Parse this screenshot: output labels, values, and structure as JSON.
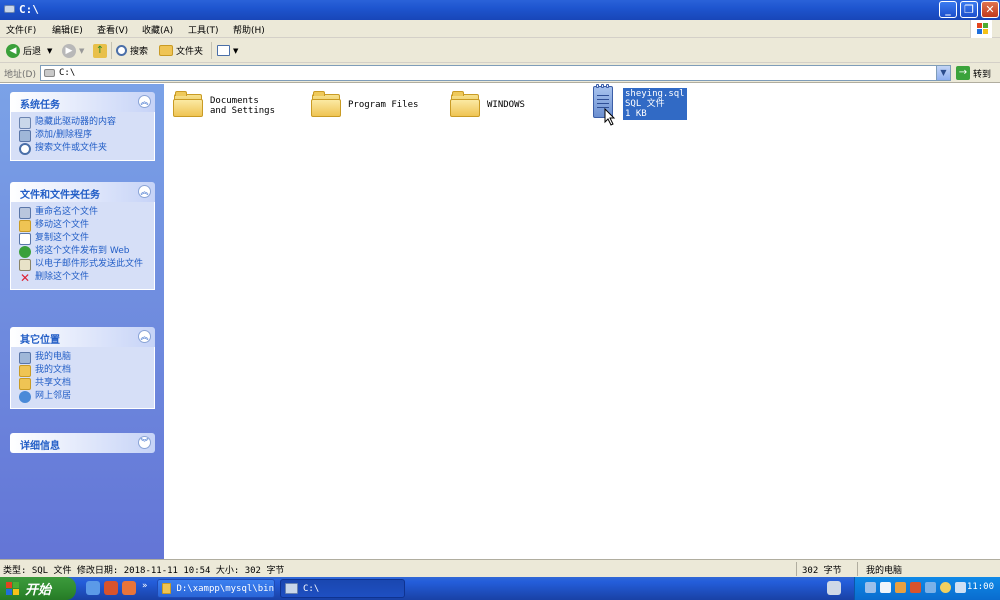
{
  "window": {
    "title": "C:\\"
  },
  "menu": [
    "文件(F)",
    "编辑(E)",
    "查看(V)",
    "收藏(A)",
    "工具(T)",
    "帮助(H)"
  ],
  "toolbar": {
    "back_label": "后退",
    "search_label": "搜索",
    "folders_label": "文件夹"
  },
  "address": {
    "label": "地址(D)",
    "value": "C:\\",
    "go_label": "转到"
  },
  "panels": {
    "system": {
      "title": "系统任务",
      "items": [
        "隐藏此驱动器的内容",
        "添加/删除程序",
        "搜索文件或文件夹"
      ]
    },
    "file_tasks": {
      "title": "文件和文件夹任务",
      "items": [
        "重命名这个文件",
        "移动这个文件",
        "复制这个文件",
        "将这个文件发布到 Web",
        "以电子邮件形式发送此文件",
        "删除这个文件"
      ]
    },
    "other_places": {
      "title": "其它位置",
      "items": [
        "我的电脑",
        "我的文档",
        "共享文档",
        "网上邻居"
      ]
    },
    "details": {
      "title": "详细信息"
    }
  },
  "files": [
    {
      "name": "Documents and Settings"
    },
    {
      "name": "Program Files"
    },
    {
      "name": "WINDOWS"
    },
    {
      "name": "sheying.sql",
      "type": "SQL 文件",
      "size": "1 KB"
    }
  ],
  "status": {
    "text": "类型: SQL 文件 修改日期: 2018-11-11 10:54 大小: 302 字节",
    "size": "302 字节",
    "zone": "我的电脑"
  },
  "taskbar": {
    "start_label": "开始",
    "windows": [
      "D:\\xampp\\mysql\\bin",
      "C:\\"
    ],
    "clock": "11:00"
  },
  "colors": {
    "titlebar": "#1e55cf",
    "taskpane": "#6375d6",
    "selection": "#316ac5",
    "taskbar": "#245edb",
    "start_button": "#2f8a2f"
  }
}
